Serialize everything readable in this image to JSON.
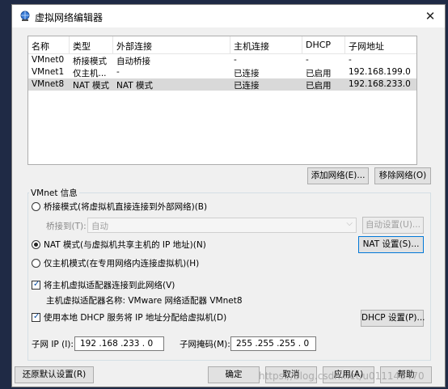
{
  "window": {
    "title": "虚拟网络编辑器",
    "close_glyph": "✕"
  },
  "table": {
    "headers": [
      "名称",
      "类型",
      "外部连接",
      "主机连接",
      "DHCP",
      "子网地址"
    ],
    "rows": [
      [
        "VMnet0",
        "桥接模式",
        "自动桥接",
        "-",
        "-",
        "-"
      ],
      [
        "VMnet1",
        "仅主机...",
        "-",
        "已连接",
        "已启用",
        "192.168.199.0"
      ],
      [
        "VMnet8",
        "NAT 模式",
        "NAT 模式",
        "已连接",
        "已启用",
        "192.168.233.0"
      ]
    ],
    "selected_row": 2
  },
  "buttons": {
    "add_network": "添加网络(E)...",
    "remove_network": "移除网络(O)",
    "auto_settings": "自动设置(U)...",
    "nat_settings": "NAT 设置(S)...",
    "dhcp_settings": "DHCP 设置(P)...",
    "restore_defaults": "还原默认设置(R)",
    "ok": "确定",
    "cancel": "取消",
    "apply": "应用(A)",
    "help": "帮助"
  },
  "vmnet_info": {
    "legend": "VMnet 信息",
    "bridge_mode": "桥接模式(将虚拟机直接连接到外部网络)(B)",
    "bridged_to_label": "桥接到(T):",
    "bridged_to_value": "自动",
    "nat_mode": "NAT 模式(与虚拟机共享主机的 IP 地址)(N)",
    "host_only_mode": "仅主机模式(在专用网络内连接虚拟机)(H)",
    "selected_mode": "nat",
    "connect_host_adapter": "将主机虚拟适配器连接到此网络(V)",
    "connect_host_adapter_checked": true,
    "host_adapter_name": "主机虚拟适配器名称: VMware 网络适配器 VMnet8",
    "use_dhcp": "使用本地 DHCP 服务将 IP 地址分配给虚拟机(D)",
    "use_dhcp_checked": true,
    "subnet_ip_label": "子网 IP (I):",
    "subnet_ip": "192 .168 .233 . 0",
    "subnet_mask_label": "子网掩码(M):",
    "subnet_mask": "255 .255 .255 . 0"
  },
  "watermark": "https://blog.csdn.net/u011146470"
}
